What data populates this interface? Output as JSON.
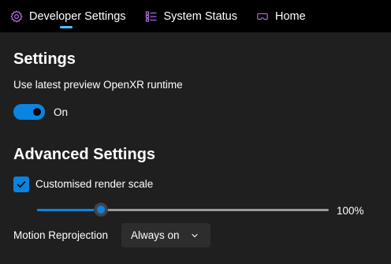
{
  "nav": {
    "tabs": [
      {
        "label": "Developer Settings",
        "icon": "gear-icon",
        "active": true
      },
      {
        "label": "System Status",
        "icon": "list-icon",
        "active": false
      },
      {
        "label": "Home",
        "icon": "vr-headset-icon",
        "active": false
      }
    ]
  },
  "settings": {
    "heading": "Settings",
    "preview_runtime_label": "Use latest preview OpenXR runtime",
    "toggle_state": "On",
    "toggle_on": true
  },
  "advanced": {
    "heading": "Advanced Settings",
    "render_scale_checkbox_label": "Customised render scale",
    "render_scale_checked": true,
    "render_scale_value_text": "100%",
    "render_scale_slider_fraction": 0.22,
    "motion_reprojection_label": "Motion Reprojection",
    "motion_reprojection_value": "Always on"
  },
  "colors": {
    "accent": "#0a84e0",
    "nav_icon": "#b46ee0",
    "nav_underline": "#4cc2ff",
    "background": "#1f1f1f",
    "nav_background": "#000000"
  }
}
